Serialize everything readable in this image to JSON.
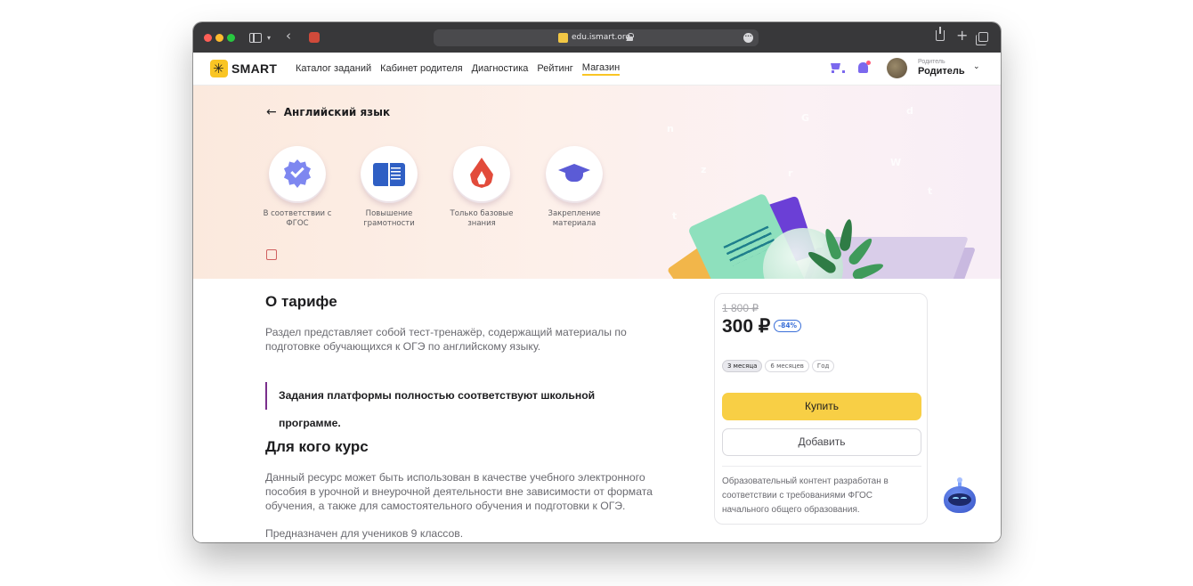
{
  "browser": {
    "url": "edu.ismart.org"
  },
  "nav": {
    "logo_text": "SMART",
    "menu": [
      {
        "label": "Каталог заданий"
      },
      {
        "label": "Кабинет родителя"
      },
      {
        "label": "Диагностика"
      },
      {
        "label": "Рейтинг"
      },
      {
        "label": "Магазин",
        "active": true
      }
    ],
    "user": {
      "role": "Родитель",
      "name": "Родитель"
    }
  },
  "hero": {
    "back_label": "Английский язык",
    "features": [
      {
        "label": "В соответствии с ФГОС",
        "icon": "verified-badge-icon"
      },
      {
        "label": "Повышение грамотности",
        "icon": "book-icon"
      },
      {
        "label": "Только базовые знания",
        "icon": "flame-icon"
      },
      {
        "label": "Закрепление материала",
        "icon": "graduation-cap-icon"
      }
    ]
  },
  "about": {
    "title": "О тарифе",
    "text": "Раздел представляет собой тест-тренажёр, содержащий материалы по подготовке обучающихся к ОГЭ по английскому языку.",
    "quote": "Задания платформы полностью соответствуют школьной программе."
  },
  "audience": {
    "title": "Для кого курс",
    "text": "Данный ресурс может быть использован в качестве учебного электронного пособия в урочной и внеурочной деятельности вне зависимости от формата обучения, а также для самостоятельного обучения и подготовки к ОГЭ.",
    "text2": "Предназначен для учеников 9 классов."
  },
  "pricing": {
    "old_price": "1 800 ₽",
    "price": "300 ₽",
    "discount": "-84%",
    "periods": [
      {
        "label": "3 месяца",
        "selected": true
      },
      {
        "label": "6 месяцев",
        "selected": false
      },
      {
        "label": "Год",
        "selected": false
      }
    ],
    "buy_label": "Купить",
    "add_label": "Добавить",
    "note": "Образовательный контент разработан в соответствии с требованиями ФГОС начального общего образования."
  },
  "colors": {
    "accent_yellow": "#f8cf45",
    "accent_purple": "#7b68ee",
    "discount_blue": "#3a6fd8",
    "quote_bar": "#7a2f8c"
  }
}
